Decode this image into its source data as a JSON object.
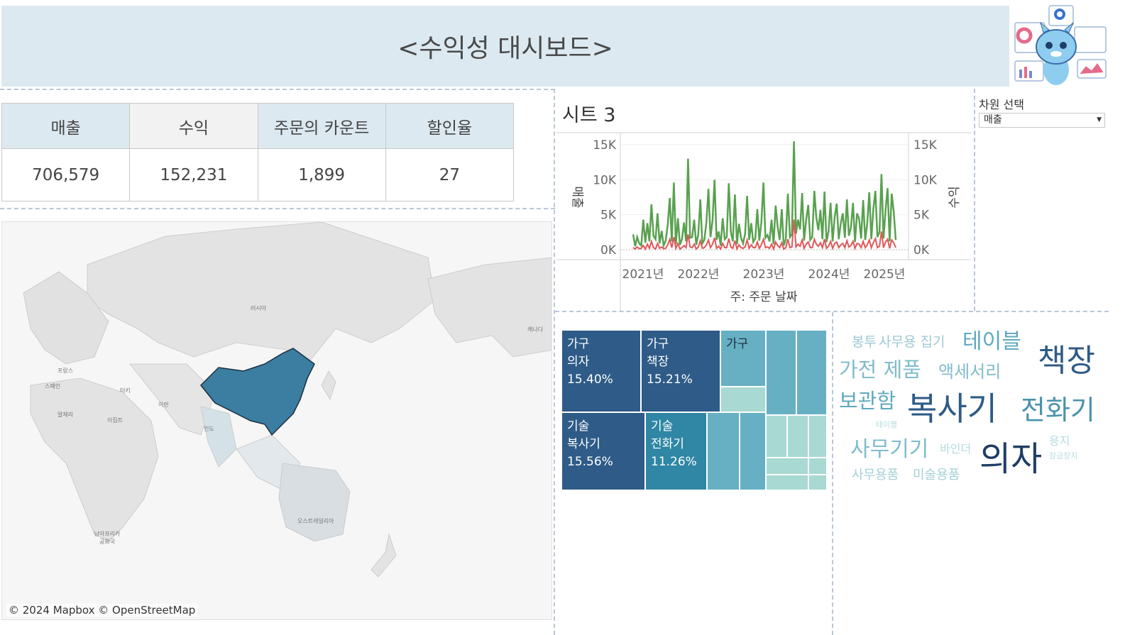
{
  "header": {
    "title": "<수익성 대시보드>"
  },
  "kpi": {
    "headers": [
      "매출",
      "수익",
      "주문의 카운트",
      "할인율"
    ],
    "values": [
      "706,579",
      "152,231",
      "1,899",
      "27"
    ]
  },
  "map": {
    "credit": "© 2024 Mapbox © OpenStreetMap",
    "labels": [
      "러시아",
      "캐나다",
      "프랑스",
      "스페인",
      "터키",
      "이란",
      "알제리",
      "이집트",
      "인도",
      "오스트레일리아",
      "남아프리카 공화국"
    ],
    "highlighted_region": "China",
    "highlight_color": "#3b7ea1"
  },
  "line_chart": {
    "sheet_title": "시트 3",
    "x_title": "주: 주문 날짜",
    "y_left_title": "매출",
    "y_right_title": "수익",
    "x_ticks": [
      "2021년",
      "2022년",
      "2023년",
      "2024년",
      "2025년"
    ],
    "y_left_ticks": [
      "15K",
      "10K",
      "5K",
      "0K"
    ],
    "y_right_ticks": [
      "15K",
      "10K",
      "5K",
      "0K"
    ],
    "series_colors": {
      "매출": "#59a14f",
      "수익": "#e15759"
    }
  },
  "chart_data": {
    "type": "line",
    "x_unit": "week",
    "x_range": [
      "2021-01",
      "2025-01"
    ],
    "ylim": [
      0,
      16000
    ],
    "series": [
      {
        "name": "매출",
        "axis": "left",
        "values": [
          2200,
          500,
          1800,
          900,
          600,
          4300,
          1000,
          3800,
          1200,
          6500,
          2000,
          1500,
          5200,
          900,
          2700,
          600,
          1300,
          3600,
          7400,
          1200,
          9600,
          800,
          4500,
          700,
          1500,
          3900,
          1200,
          13000,
          1700,
          1800,
          4300,
          700,
          2200,
          7200,
          900,
          1400,
          4000,
          8700,
          1800,
          4200,
          10000,
          1400,
          2600,
          600,
          4500,
          1500,
          1800,
          9500,
          2500,
          1200,
          7900,
          800,
          3700,
          1700,
          900,
          2300,
          7700,
          1400,
          3800,
          1100,
          1600,
          5800,
          1300,
          3900,
          9600,
          1700,
          2100,
          1200,
          4300,
          800,
          6300,
          3300,
          1400,
          5800,
          600,
          1500,
          8000,
          1800,
          2200,
          15500,
          2300,
          4300,
          2900,
          8100,
          1300,
          4300,
          6400,
          1400,
          1800,
          8400,
          4600,
          2800,
          5700,
          1500,
          8300,
          1100,
          2600,
          6700,
          1200,
          4700,
          6600,
          1500,
          3800,
          5200,
          1700,
          7200,
          2000,
          3200,
          6700,
          1100,
          5200,
          4400,
          1600,
          7100,
          1400,
          3700,
          8200,
          1500,
          5800,
          8400,
          1800,
          2500,
          10800,
          1600,
          5700,
          8800,
          1200,
          8000,
          5500,
          1400
        ]
      },
      {
        "name": "수익",
        "axis": "left",
        "values": [
          300,
          100,
          400,
          150,
          200,
          600,
          100,
          800,
          200,
          1200,
          300,
          100,
          900,
          200,
          400,
          150,
          200,
          700,
          1500,
          300,
          1800,
          200,
          900,
          100,
          300,
          600,
          300,
          2200,
          400,
          300,
          800,
          100,
          400,
          1300,
          200,
          300,
          700,
          1400,
          300,
          800,
          1700,
          200,
          500,
          100,
          900,
          300,
          300,
          1600,
          400,
          200,
          1300,
          100,
          700,
          300,
          200,
          400,
          1400,
          200,
          700,
          300,
          300,
          1100,
          200,
          700,
          1500,
          300,
          400,
          200,
          800,
          100,
          1100,
          600,
          300,
          1000,
          100,
          300,
          1500,
          300,
          400,
          4300,
          400,
          800,
          500,
          1400,
          200,
          800,
          1100,
          300,
          300,
          1500,
          800,
          500,
          1000,
          300,
          1500,
          200,
          500,
          1200,
          200,
          900,
          1100,
          300,
          700,
          900,
          300,
          1300,
          400,
          600,
          1200,
          200,
          900,
          800,
          300,
          1200,
          300,
          700,
          1400,
          300,
          1000,
          1600,
          300,
          500,
          2600,
          300,
          1100,
          1500,
          200,
          1400,
          1000,
          300
        ]
      }
    ]
  },
  "filter": {
    "title": "차원 선택",
    "selected": "매출"
  },
  "treemap": {
    "cells": [
      {
        "line1": "가구",
        "line2": "의자",
        "line3": "15.40%"
      },
      {
        "line1": "가구",
        "line2": "책장",
        "line3": "15.21%"
      },
      {
        "line1": "가구",
        "line2": "",
        "line3": ""
      },
      {
        "line1": "기술",
        "line2": "복사기",
        "line3": "15.56%"
      },
      {
        "line1": "기술",
        "line2": "전화기",
        "line3": "11.26%"
      }
    ],
    "colors": {
      "dark": "#2e5b87",
      "mid": "#2f86a5",
      "light": "#67b0c3",
      "pale": "#a8d9d3"
    }
  },
  "word_cloud": {
    "words": [
      "봉투",
      "사무용 집기",
      "테이블",
      "책장",
      "가전 제품",
      "액세서리",
      "보관함",
      "복사기",
      "전화기",
      "테이블",
      "용지",
      "사무기기",
      "바인더",
      "의자",
      "잠금장치",
      "사무용품",
      "미술용품"
    ]
  }
}
